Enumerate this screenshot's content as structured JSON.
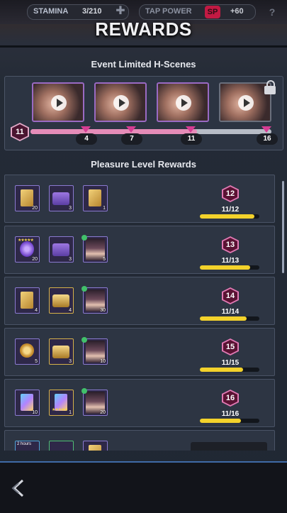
{
  "topbar": {
    "stamina_label": "STAMINA",
    "stamina_value": "3/210",
    "tap_label": "TAP POWER",
    "sp_badge": "SP",
    "tap_value": "+60",
    "help": "?"
  },
  "title": "REWARDS",
  "scenes": {
    "heading": "Event Limited H-Scenes",
    "current_level": "11",
    "milestones": [
      "4",
      "7",
      "11",
      "16"
    ],
    "progress_fraction": 0.69
  },
  "rewards": {
    "heading": "Pleasure Level Rewards",
    "rows": [
      {
        "level": "12",
        "progress": "11/12",
        "fill": 0.92,
        "counts": [
          "20",
          "3",
          "1"
        ]
      },
      {
        "level": "13",
        "progress": "11/13",
        "fill": 0.85,
        "counts": [
          "20",
          "3",
          "5"
        ]
      },
      {
        "level": "14",
        "progress": "11/14",
        "fill": 0.79,
        "counts": [
          "4",
          "4",
          "30"
        ]
      },
      {
        "level": "15",
        "progress": "11/15",
        "fill": 0.73,
        "counts": [
          "5",
          "3",
          "10"
        ]
      },
      {
        "level": "16",
        "progress": "11/16",
        "fill": 0.69,
        "counts": [
          "10",
          "1",
          "20"
        ]
      }
    ],
    "partial_row_label": "2 hours"
  },
  "colors": {
    "accent_pink": "#e58cb8",
    "bar_yellow": "#f3d22b",
    "milestone": "#d63d93"
  }
}
